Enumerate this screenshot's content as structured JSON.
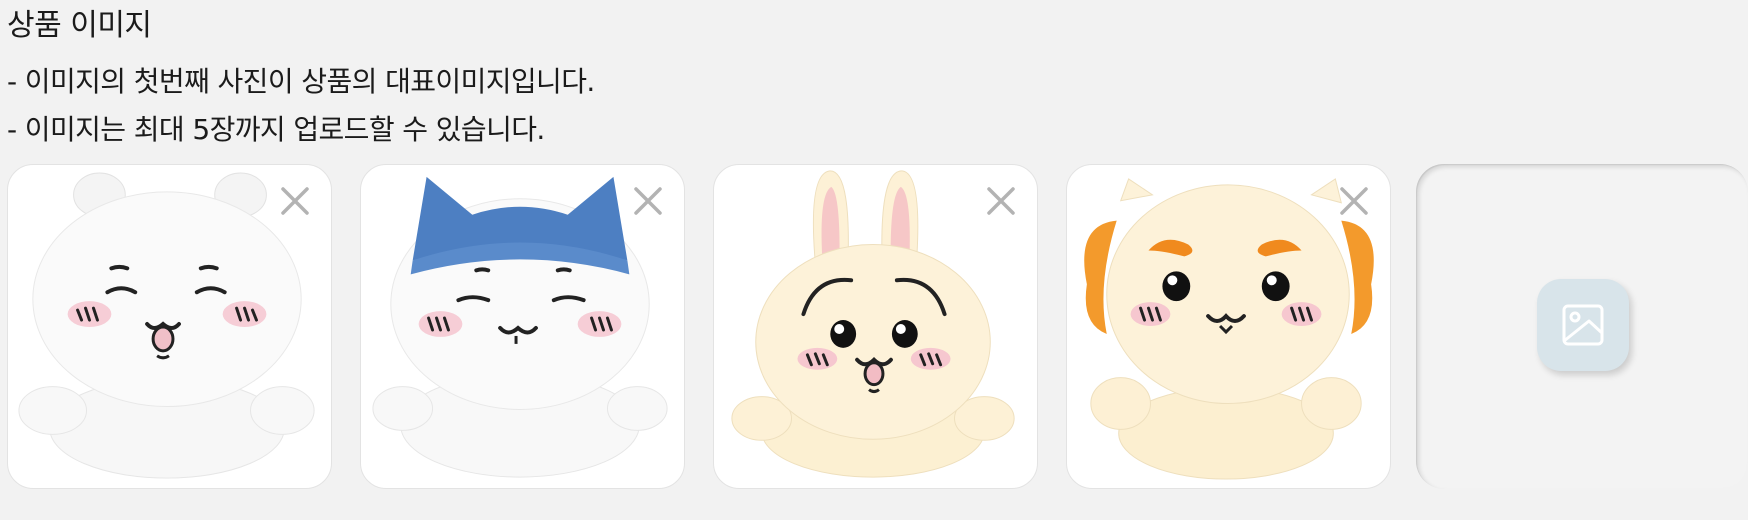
{
  "section": {
    "title": "상품 이미지",
    "guides": [
      "- 이미지의 첫번째 사진이 상품의 대표이미지입니다.",
      "- 이미지는 최대 5장까지 업로드할 수 있습니다."
    ]
  },
  "images": [
    {
      "icon": "plush-bear-image",
      "remove_icon": "close-icon"
    },
    {
      "icon": "plush-cat-image",
      "remove_icon": "close-icon"
    },
    {
      "icon": "plush-rabbit-image",
      "remove_icon": "close-icon"
    },
    {
      "icon": "plush-lion-image",
      "remove_icon": "close-icon"
    }
  ],
  "upload": {
    "icon": "image-upload-icon"
  },
  "colors": {
    "background": "#f2f2f2",
    "card_border": "#e3e3e3",
    "close_icon": "#b3b3b3",
    "upload_icon_bg": "#d8e4ea",
    "upload_icon_stroke": "#ffffff"
  }
}
